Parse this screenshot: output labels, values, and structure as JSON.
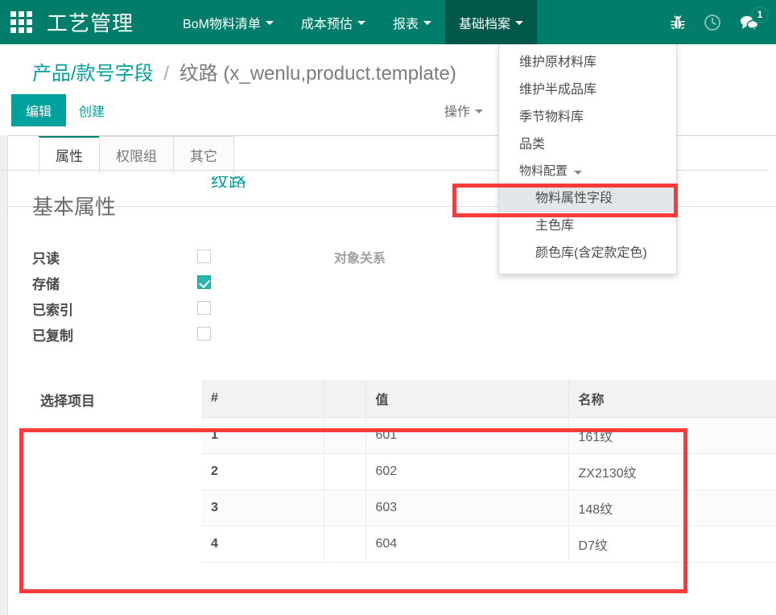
{
  "topbar": {
    "apps_icon": "apps-grid-icon",
    "brand": "工艺管理",
    "menu": [
      {
        "label": "BoM物料清单",
        "has_caret": true,
        "active": false
      },
      {
        "label": "成本预估",
        "has_caret": true,
        "active": false
      },
      {
        "label": "报表",
        "has_caret": true,
        "active": false
      },
      {
        "label": "基础档案",
        "has_caret": true,
        "active": true
      }
    ],
    "sys_icons": [
      {
        "name": "bug-icon",
        "glyph": "bug"
      },
      {
        "name": "clock-icon",
        "glyph": "clock"
      },
      {
        "name": "messages-icon",
        "glyph": "chat",
        "badge": "1"
      }
    ]
  },
  "dropdown": {
    "items": [
      {
        "label": "维护原材料库",
        "type": "item",
        "highlighted": false
      },
      {
        "label": "维护半成品库",
        "type": "item",
        "highlighted": false
      },
      {
        "label": "季节物料库",
        "type": "item",
        "highlighted": false
      },
      {
        "label": "品类",
        "type": "item",
        "highlighted": false
      },
      {
        "label": "物料配置",
        "type": "group",
        "highlighted": false
      },
      {
        "label": "物料属性字段",
        "type": "sub",
        "highlighted": true
      },
      {
        "label": "主色库",
        "type": "sub",
        "highlighted": false
      },
      {
        "label": "颜色库(含定款定色)",
        "type": "sub",
        "highlighted": false
      }
    ]
  },
  "breadcrumb": {
    "parent": "产品/款号字段",
    "separator": "/",
    "current": "纹路 (x_wenlu,product.template)"
  },
  "controls": {
    "edit_label": "编辑",
    "create_label": "创建",
    "action_label": "操作"
  },
  "sheet": {
    "ghost_title": "纹路"
  },
  "tabs": [
    {
      "label": "属性",
      "active": true
    },
    {
      "label": "权限组",
      "active": false
    },
    {
      "label": "其它",
      "active": false
    }
  ],
  "attributes": {
    "section_title": "基本属性",
    "extra_label": "对象关系",
    "rows": [
      {
        "label": "只读",
        "checked": false
      },
      {
        "label": "存储",
        "checked": true
      },
      {
        "label": "已索引",
        "checked": false
      },
      {
        "label": "已复制",
        "checked": false
      }
    ]
  },
  "select_items": {
    "label": "选择项目",
    "columns": [
      "#",
      "",
      "值",
      "名称"
    ],
    "rows": [
      {
        "index": "1",
        "blank": "",
        "value": "601",
        "name": "161纹"
      },
      {
        "index": "2",
        "blank": "",
        "value": "602",
        "name": "ZX2130纹"
      },
      {
        "index": "3",
        "blank": "",
        "value": "603",
        "name": "148纹"
      },
      {
        "index": "4",
        "blank": "",
        "value": "604",
        "name": "D7纹"
      }
    ]
  },
  "colors": {
    "brand_teal": "#017E6B",
    "nav_active": "#00584B",
    "accent": "#00a09d",
    "checkbox_on": "#27b6ab",
    "annotation_red": "#f93b3b",
    "highlight_gray": "#e3e7e9"
  }
}
